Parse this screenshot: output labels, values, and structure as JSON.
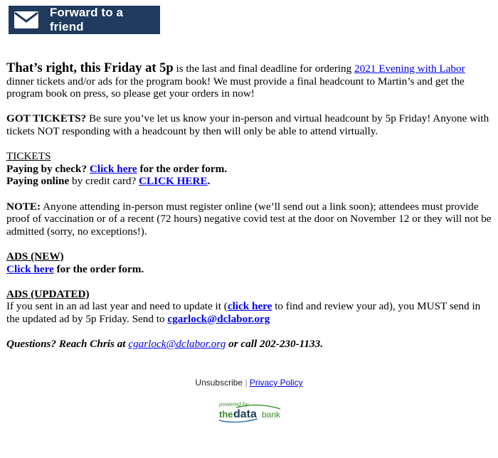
{
  "forward_button": {
    "label": "Forward to a friend",
    "icon": "envelope-icon",
    "bg_color": "#1f3a5c"
  },
  "intro": {
    "lead_bold": "That’s right, this Friday at 5p",
    "text_before_link": " is the last and final deadline for ordering ",
    "link": "2021 Evening with Labor",
    "text_after_link": " dinner tickets and/or ads for the program book! We must provide a final headcount to Martin’s and get the program book on press, so please get your orders in now!"
  },
  "got_tickets": {
    "bold": "GOT TICKETS?",
    "text": " Be sure you’ve let us know your in-person and virtual headcount by 5p Friday! Anyone with tickets NOT responding with a headcount by then will only be able to attend virtually."
  },
  "tickets": {
    "heading": "TICKETS",
    "check_bold": "Paying by check? ",
    "check_link": "Click here",
    "check_after": " for the order form.",
    "online_bold": "Paying online",
    "online_text": " by credit card? ",
    "online_link": "CLICK HERE",
    "online_after": "."
  },
  "note": {
    "bold": "NOTE:",
    "text": " Anyone attending in-person must register online (we’ll send out a link soon); attendees must provide proof of vaccination or of a recent (72 hours) negative covid test at the door on November 12 or they will not be admitted (sorry, no exceptions!)."
  },
  "ads_new": {
    "heading": "ADS (NEW)",
    "link": "Click here",
    "after": " for the order form."
  },
  "ads_updated": {
    "heading": "ADS (UPDATED)",
    "text_before": "If you sent in an ad last year and need to update it (",
    "link": "click here",
    "text_after": " to find and review your ad), you MUST send in the updated ad by 5p Friday. Send to ",
    "email_link": "cgarlock@dclabor.org"
  },
  "questions": {
    "before": "Questions? Reach Chris at ",
    "email_link": "cgarlock@dclabor.org",
    "after": " or call 202-230-1133."
  },
  "footer": {
    "unsubscribe": "Unsubscribe",
    "separator": " | ",
    "privacy": "Privacy Policy",
    "powered_by": "powered by",
    "brand_the": "the",
    "brand_data": "data",
    "brand_bank": "bank"
  }
}
